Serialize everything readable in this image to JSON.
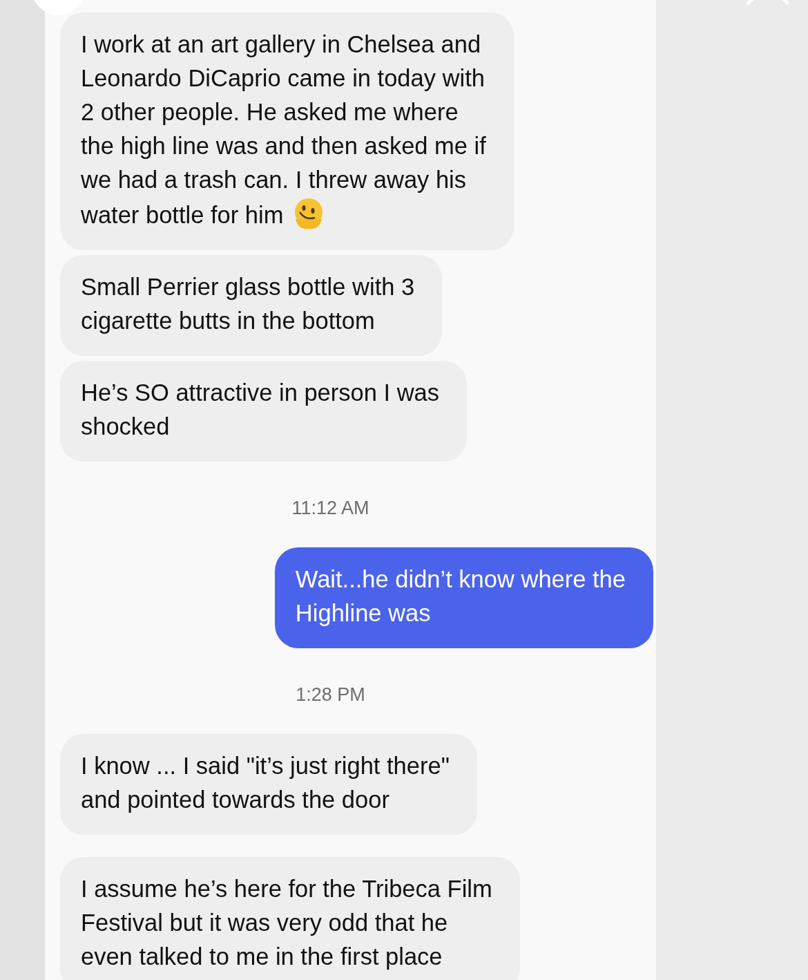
{
  "messages": [
    {
      "kind": "incoming",
      "lines": [
        "I work at an art gallery in Chelsea and",
        "Leonardo DiCaprio came in today with",
        "2 other people. He asked me where",
        "the high line was and then asked me if",
        "we had a trash can. I threw away his",
        "water bottle for him"
      ],
      "ends_with_emoji": true
    },
    {
      "kind": "incoming",
      "lines": [
        "Small Perrier glass bottle with 3",
        "cigarette butts in the bottom"
      ]
    },
    {
      "kind": "incoming",
      "lines": [
        "He’s SO attractive in person I was",
        "shocked"
      ]
    },
    {
      "kind": "timestamp",
      "lines": [
        "11:12 AM"
      ]
    },
    {
      "kind": "outgoing",
      "lines": [
        "Wait...he didn’t know where the",
        "Highline was"
      ]
    },
    {
      "kind": "timestamp",
      "lines": [
        "1:28 PM"
      ]
    },
    {
      "kind": "incoming",
      "lines": [
        "I know ... I said \"it’s just right there\"",
        "and pointed towards the door"
      ]
    },
    {
      "kind": "incoming",
      "lines": [
        "I assume he’s here for the Tribeca Film",
        "Festival but it was very odd that he",
        "even talked to me in the first place"
      ]
    }
  ]
}
